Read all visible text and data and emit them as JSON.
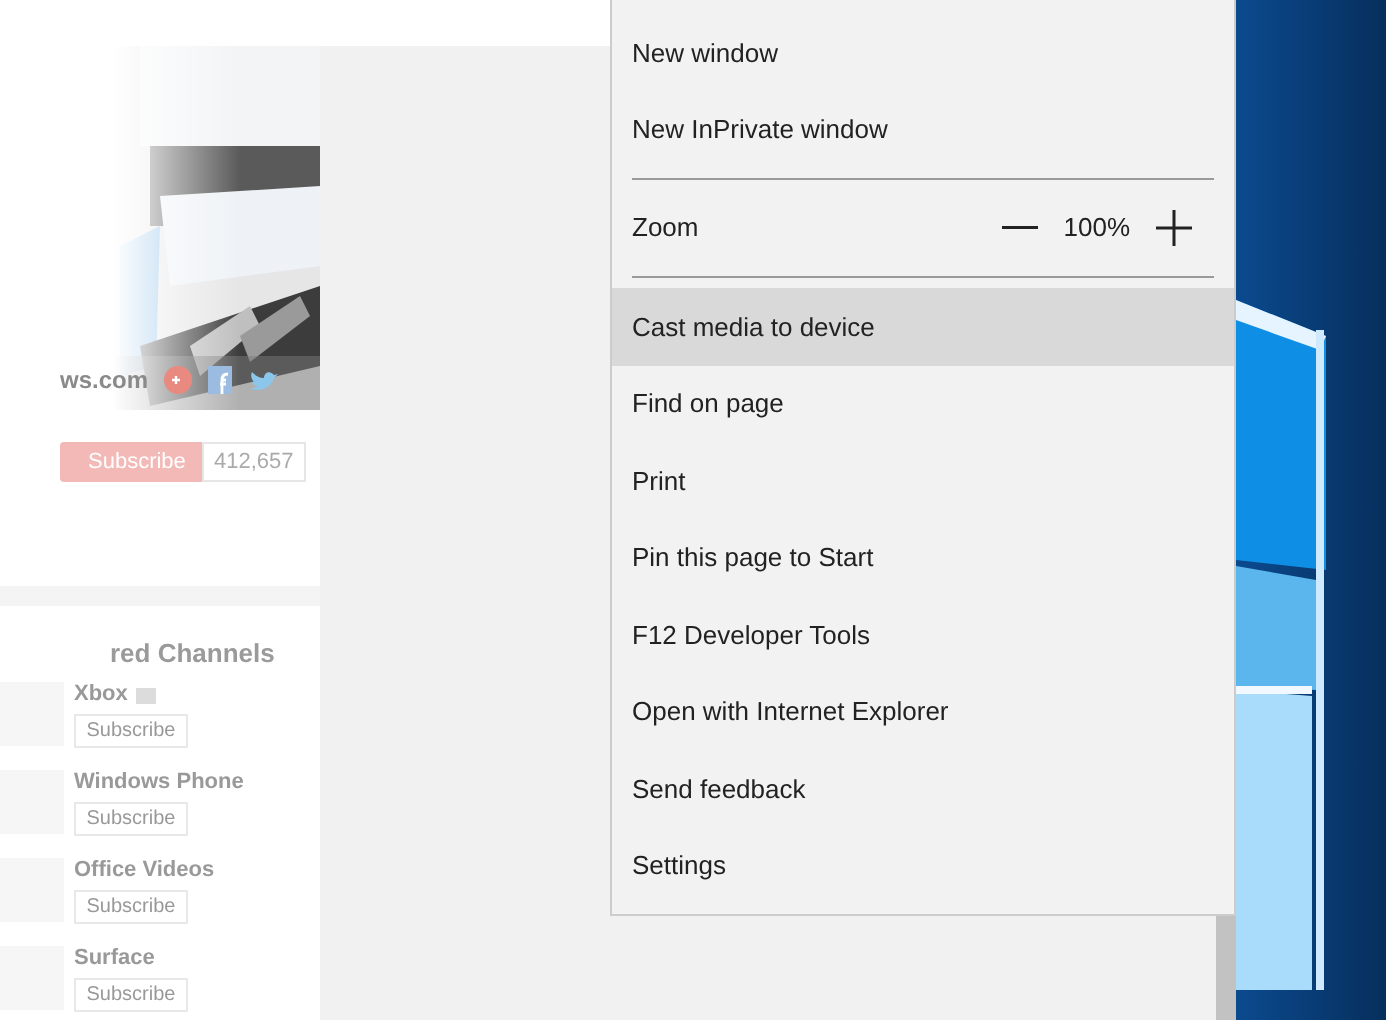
{
  "page": {
    "channel_site": "ws.com",
    "subscribe": "Subscribe",
    "subscriber_count": "412,657",
    "featured_heading": "red Channels",
    "channels": [
      {
        "name": "Xbox",
        "verified": true,
        "button": "Subscribe"
      },
      {
        "name": "Windows Phone",
        "verified": false,
        "button": "Subscribe"
      },
      {
        "name": "Office Videos",
        "verified": false,
        "button": "Subscribe"
      },
      {
        "name": "Surface",
        "verified": false,
        "button": "Subscribe"
      }
    ]
  },
  "menu": {
    "items": [
      {
        "kind": "item",
        "label": "New window",
        "selected": false
      },
      {
        "kind": "item",
        "label": "New InPrivate window",
        "selected": false
      },
      {
        "kind": "separator"
      },
      {
        "kind": "zoom",
        "label": "Zoom",
        "value": "100%"
      },
      {
        "kind": "separator"
      },
      {
        "kind": "item",
        "label": "Cast media to device",
        "selected": true
      },
      {
        "kind": "item",
        "label": "Find on page",
        "selected": false
      },
      {
        "kind": "item",
        "label": "Print",
        "selected": false
      },
      {
        "kind": "item",
        "label": "Pin this page to Start",
        "selected": false
      },
      {
        "kind": "item",
        "label": "F12 Developer Tools",
        "selected": false
      },
      {
        "kind": "item",
        "label": "Open with Internet Explorer",
        "selected": false
      },
      {
        "kind": "item",
        "label": "Send feedback",
        "selected": false
      },
      {
        "kind": "item",
        "label": "Settings",
        "selected": false
      }
    ]
  }
}
